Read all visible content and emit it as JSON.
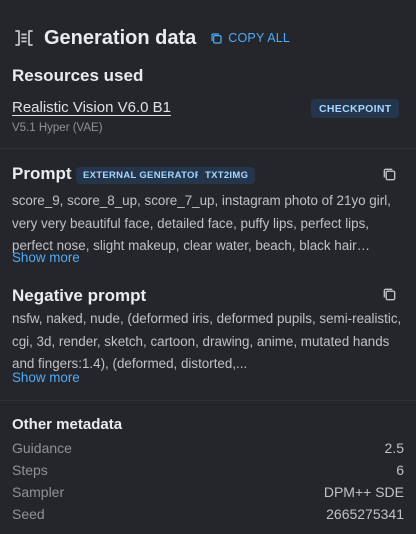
{
  "header": {
    "title": "Generation data",
    "copy_all_label": "COPY ALL"
  },
  "resources": {
    "heading": "Resources used",
    "items": [
      {
        "name": "Realistic Vision V6.0 B1",
        "subtitle": "V5.1 Hyper (VAE)",
        "type_badge": "CHECKPOINT"
      }
    ]
  },
  "prompt": {
    "title": "Prompt",
    "badges": [
      "EXTERNAL GENERATOR",
      "TXT2IMG"
    ],
    "text": "score_9, score_8_up, score_7_up, instagram photo of 21yo girl, very very beautiful face, detailed face, puffy lips, perfect lips, perfect nose, slight makeup, clear water, beach, black hair…",
    "show_more_label": "Show more",
    "copy_icon": "copy-icon"
  },
  "negative_prompt": {
    "title": "Negative prompt",
    "text": "nsfw, naked, nude, (deformed iris, deformed pupils, semi-realistic, cgi, 3d, render, sketch, cartoon, drawing, anime, mutated hands and fingers:1.4), (deformed, distorted,...",
    "show_more_label": "Show more",
    "copy_icon": "copy-icon"
  },
  "metadata": {
    "heading": "Other metadata",
    "rows": [
      {
        "key": "Guidance",
        "value": "2.5"
      },
      {
        "key": "Steps",
        "value": "6"
      },
      {
        "key": "Sampler",
        "value": "DPM++ SDE"
      },
      {
        "key": "Seed",
        "value": "2665275341"
      }
    ]
  },
  "colors": {
    "background": "#25262b",
    "accent": "#4dabf7",
    "badge_bg": "#25354b",
    "badge_text": "#a5d8ff"
  }
}
